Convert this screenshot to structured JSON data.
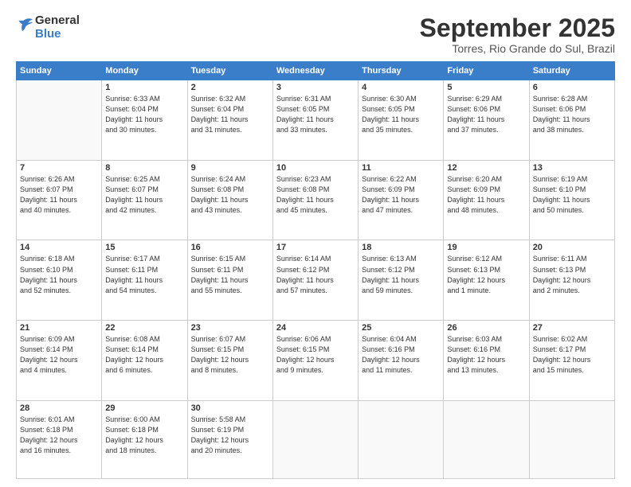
{
  "logo": {
    "general": "General",
    "blue": "Blue"
  },
  "title": "September 2025",
  "location": "Torres, Rio Grande do Sul, Brazil",
  "days_header": [
    "Sunday",
    "Monday",
    "Tuesday",
    "Wednesday",
    "Thursday",
    "Friday",
    "Saturday"
  ],
  "weeks": [
    [
      {
        "day": "",
        "info": ""
      },
      {
        "day": "1",
        "info": "Sunrise: 6:33 AM\nSunset: 6:04 PM\nDaylight: 11 hours\nand 30 minutes."
      },
      {
        "day": "2",
        "info": "Sunrise: 6:32 AM\nSunset: 6:04 PM\nDaylight: 11 hours\nand 31 minutes."
      },
      {
        "day": "3",
        "info": "Sunrise: 6:31 AM\nSunset: 6:05 PM\nDaylight: 11 hours\nand 33 minutes."
      },
      {
        "day": "4",
        "info": "Sunrise: 6:30 AM\nSunset: 6:05 PM\nDaylight: 11 hours\nand 35 minutes."
      },
      {
        "day": "5",
        "info": "Sunrise: 6:29 AM\nSunset: 6:06 PM\nDaylight: 11 hours\nand 37 minutes."
      },
      {
        "day": "6",
        "info": "Sunrise: 6:28 AM\nSunset: 6:06 PM\nDaylight: 11 hours\nand 38 minutes."
      }
    ],
    [
      {
        "day": "7",
        "info": "Sunrise: 6:26 AM\nSunset: 6:07 PM\nDaylight: 11 hours\nand 40 minutes."
      },
      {
        "day": "8",
        "info": "Sunrise: 6:25 AM\nSunset: 6:07 PM\nDaylight: 11 hours\nand 42 minutes."
      },
      {
        "day": "9",
        "info": "Sunrise: 6:24 AM\nSunset: 6:08 PM\nDaylight: 11 hours\nand 43 minutes."
      },
      {
        "day": "10",
        "info": "Sunrise: 6:23 AM\nSunset: 6:08 PM\nDaylight: 11 hours\nand 45 minutes."
      },
      {
        "day": "11",
        "info": "Sunrise: 6:22 AM\nSunset: 6:09 PM\nDaylight: 11 hours\nand 47 minutes."
      },
      {
        "day": "12",
        "info": "Sunrise: 6:20 AM\nSunset: 6:09 PM\nDaylight: 11 hours\nand 48 minutes."
      },
      {
        "day": "13",
        "info": "Sunrise: 6:19 AM\nSunset: 6:10 PM\nDaylight: 11 hours\nand 50 minutes."
      }
    ],
    [
      {
        "day": "14",
        "info": "Sunrise: 6:18 AM\nSunset: 6:10 PM\nDaylight: 11 hours\nand 52 minutes."
      },
      {
        "day": "15",
        "info": "Sunrise: 6:17 AM\nSunset: 6:11 PM\nDaylight: 11 hours\nand 54 minutes."
      },
      {
        "day": "16",
        "info": "Sunrise: 6:15 AM\nSunset: 6:11 PM\nDaylight: 11 hours\nand 55 minutes."
      },
      {
        "day": "17",
        "info": "Sunrise: 6:14 AM\nSunset: 6:12 PM\nDaylight: 11 hours\nand 57 minutes."
      },
      {
        "day": "18",
        "info": "Sunrise: 6:13 AM\nSunset: 6:12 PM\nDaylight: 11 hours\nand 59 minutes."
      },
      {
        "day": "19",
        "info": "Sunrise: 6:12 AM\nSunset: 6:13 PM\nDaylight: 12 hours\nand 1 minute."
      },
      {
        "day": "20",
        "info": "Sunrise: 6:11 AM\nSunset: 6:13 PM\nDaylight: 12 hours\nand 2 minutes."
      }
    ],
    [
      {
        "day": "21",
        "info": "Sunrise: 6:09 AM\nSunset: 6:14 PM\nDaylight: 12 hours\nand 4 minutes."
      },
      {
        "day": "22",
        "info": "Sunrise: 6:08 AM\nSunset: 6:14 PM\nDaylight: 12 hours\nand 6 minutes."
      },
      {
        "day": "23",
        "info": "Sunrise: 6:07 AM\nSunset: 6:15 PM\nDaylight: 12 hours\nand 8 minutes."
      },
      {
        "day": "24",
        "info": "Sunrise: 6:06 AM\nSunset: 6:15 PM\nDaylight: 12 hours\nand 9 minutes."
      },
      {
        "day": "25",
        "info": "Sunrise: 6:04 AM\nSunset: 6:16 PM\nDaylight: 12 hours\nand 11 minutes."
      },
      {
        "day": "26",
        "info": "Sunrise: 6:03 AM\nSunset: 6:16 PM\nDaylight: 12 hours\nand 13 minutes."
      },
      {
        "day": "27",
        "info": "Sunrise: 6:02 AM\nSunset: 6:17 PM\nDaylight: 12 hours\nand 15 minutes."
      }
    ],
    [
      {
        "day": "28",
        "info": "Sunrise: 6:01 AM\nSunset: 6:18 PM\nDaylight: 12 hours\nand 16 minutes."
      },
      {
        "day": "29",
        "info": "Sunrise: 6:00 AM\nSunset: 6:18 PM\nDaylight: 12 hours\nand 18 minutes."
      },
      {
        "day": "30",
        "info": "Sunrise: 5:58 AM\nSunset: 6:19 PM\nDaylight: 12 hours\nand 20 minutes."
      },
      {
        "day": "",
        "info": ""
      },
      {
        "day": "",
        "info": ""
      },
      {
        "day": "",
        "info": ""
      },
      {
        "day": "",
        "info": ""
      }
    ]
  ]
}
